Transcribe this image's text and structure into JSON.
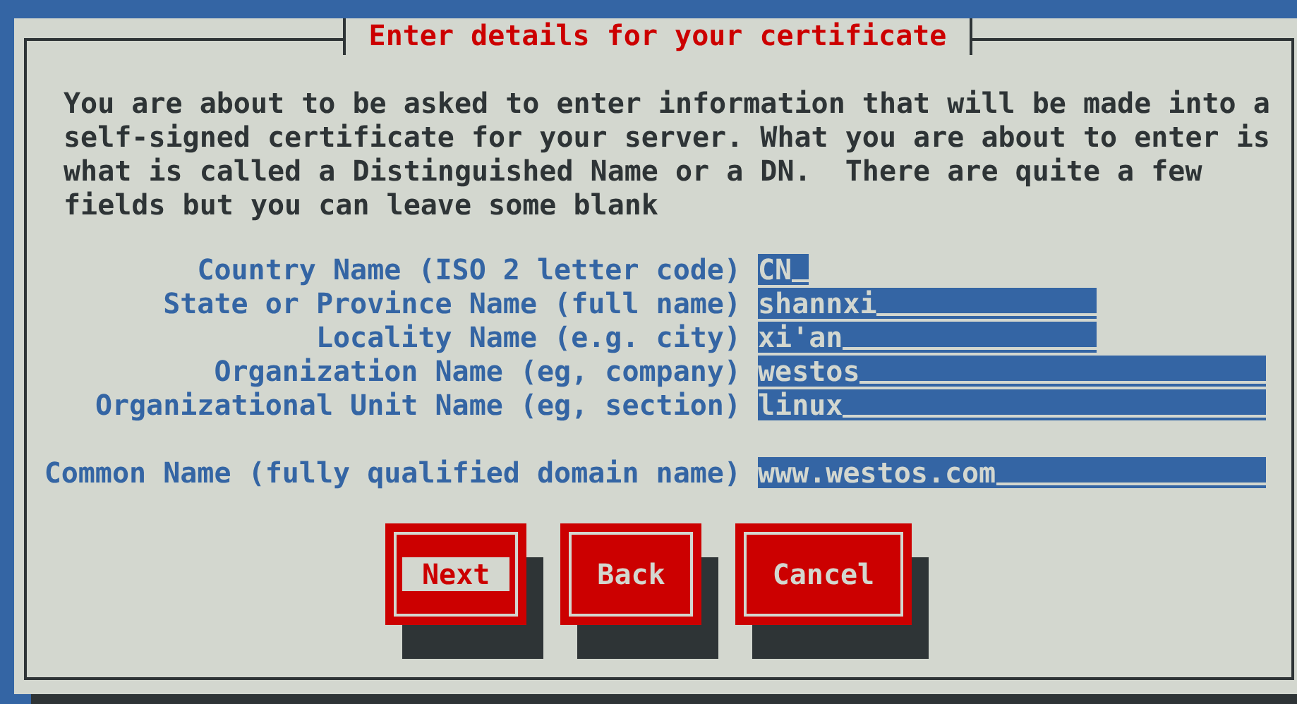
{
  "dialog": {
    "title": "Enter details for your certificate",
    "message": "You are about to be asked to enter information that will be made into a self-signed certificate for your server. What you are about to enter is what is called a Distinguished Name or a DN.  There are quite a few fields but you can leave some blank",
    "fields": [
      {
        "label": "Country Name (ISO 2 letter code)",
        "value": "CN"
      },
      {
        "label": "State or Province Name (full name)",
        "value": "shannxi"
      },
      {
        "label": "Locality Name (e.g. city)",
        "value": "xi'an"
      },
      {
        "label": "Organization Name (eg, company)",
        "value": "westos"
      },
      {
        "label": "Organizational Unit Name (eg, section)",
        "value": "linux"
      },
      {
        "label": "Common Name (fully qualified domain name)",
        "value": "www.westos.com"
      }
    ],
    "buttons": [
      {
        "label": "Next",
        "selected": true
      },
      {
        "label": "Back",
        "selected": false
      },
      {
        "label": "Cancel",
        "selected": false
      }
    ]
  }
}
